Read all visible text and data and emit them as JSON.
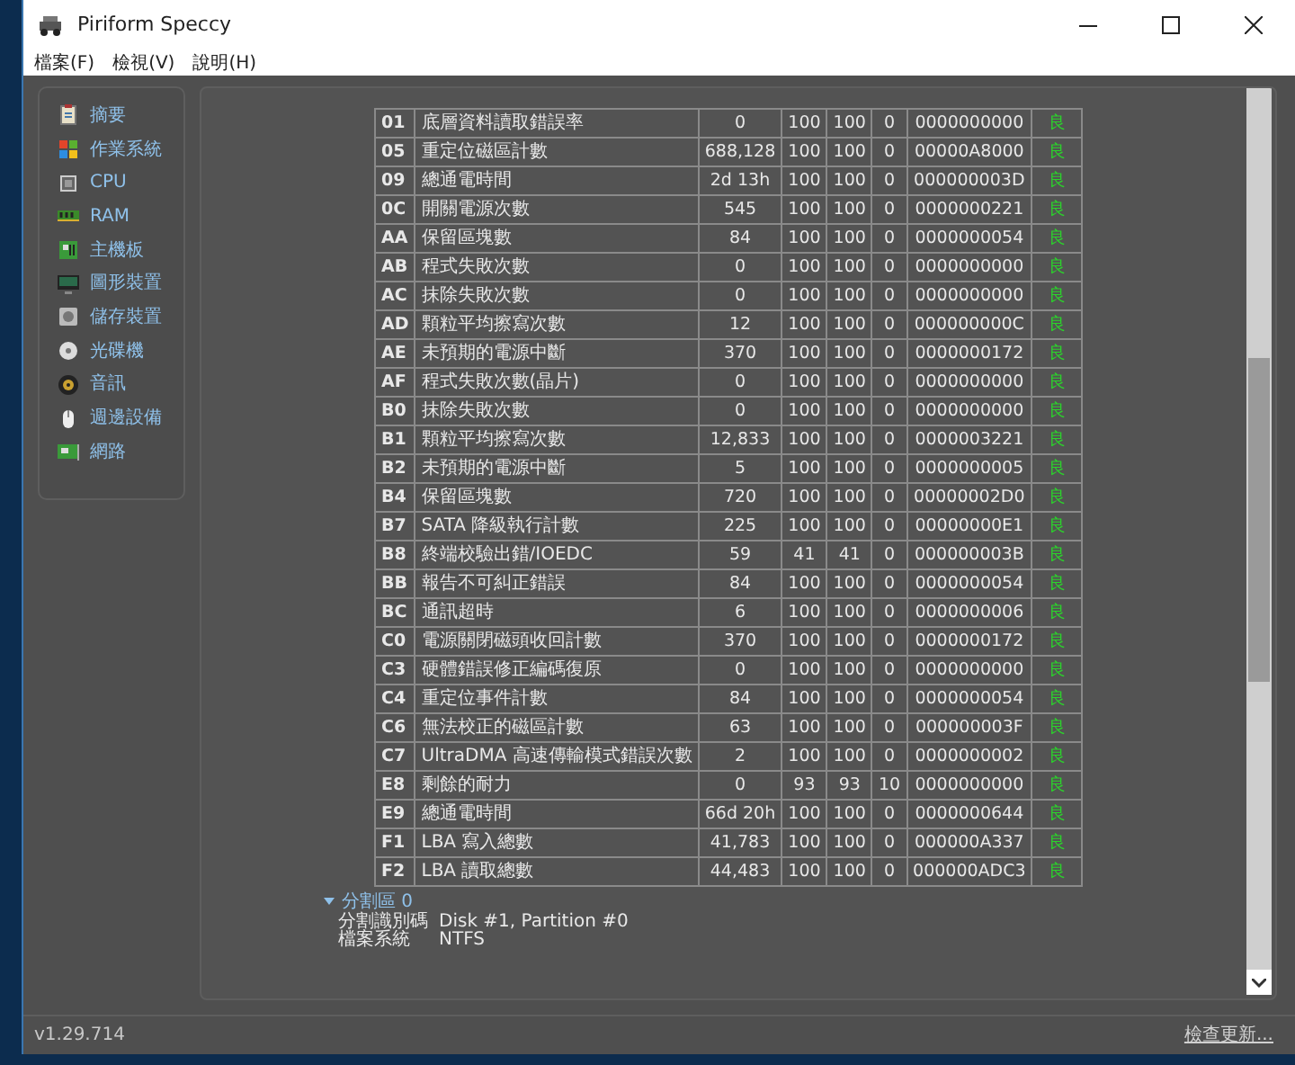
{
  "window": {
    "title": "Piriform Speccy"
  },
  "menu": [
    "檔案(F)",
    "檢視(V)",
    "說明(H)"
  ],
  "sidebar": {
    "items": [
      {
        "label": "摘要",
        "kind": "summary",
        "selected": false
      },
      {
        "label": "作業系統",
        "kind": "os",
        "selected": false
      },
      {
        "label": "CPU",
        "kind": "cpu",
        "selected": false
      },
      {
        "label": "RAM",
        "kind": "ram",
        "selected": false
      },
      {
        "label": "主機板",
        "kind": "board",
        "selected": false
      },
      {
        "label": "圖形裝置",
        "kind": "display",
        "selected": false
      },
      {
        "label": "儲存裝置",
        "kind": "storage",
        "selected": false
      },
      {
        "label": "光碟機",
        "kind": "disc",
        "selected": false
      },
      {
        "label": "音訊",
        "kind": "audio",
        "selected": false
      },
      {
        "label": "週邊設備",
        "kind": "mouse",
        "selected": false
      },
      {
        "label": "網路",
        "kind": "network",
        "selected": false
      }
    ]
  },
  "smart_table": {
    "rows": [
      [
        "01",
        "底層資料讀取錯誤率",
        "0",
        "100",
        "100",
        "0",
        "0000000000",
        "良"
      ],
      [
        "05",
        "重定位磁區計數",
        "688,128",
        "100",
        "100",
        "0",
        "00000A8000",
        "良"
      ],
      [
        "09",
        "總通電時間",
        "2d 13h",
        "100",
        "100",
        "0",
        "000000003D",
        "良"
      ],
      [
        "0C",
        "開關電源次數",
        "545",
        "100",
        "100",
        "0",
        "0000000221",
        "良"
      ],
      [
        "AA",
        "保留區塊數",
        "84",
        "100",
        "100",
        "0",
        "0000000054",
        "良"
      ],
      [
        "AB",
        "程式失敗次數",
        "0",
        "100",
        "100",
        "0",
        "0000000000",
        "良"
      ],
      [
        "AC",
        "抹除失敗次數",
        "0",
        "100",
        "100",
        "0",
        "0000000000",
        "良"
      ],
      [
        "AD",
        "顆粒平均擦寫次數",
        "12",
        "100",
        "100",
        "0",
        "000000000C",
        "良"
      ],
      [
        "AE",
        "未預期的電源中斷",
        "370",
        "100",
        "100",
        "0",
        "0000000172",
        "良"
      ],
      [
        "AF",
        "程式失敗次數(晶片)",
        "0",
        "100",
        "100",
        "0",
        "0000000000",
        "良"
      ],
      [
        "B0",
        "抹除失敗次數",
        "0",
        "100",
        "100",
        "0",
        "0000000000",
        "良"
      ],
      [
        "B1",
        "顆粒平均擦寫次數",
        "12,833",
        "100",
        "100",
        "0",
        "0000003221",
        "良"
      ],
      [
        "B2",
        "未預期的電源中斷",
        "5",
        "100",
        "100",
        "0",
        "0000000005",
        "良"
      ],
      [
        "B4",
        "保留區塊數",
        "720",
        "100",
        "100",
        "0",
        "00000002D0",
        "良"
      ],
      [
        "B7",
        "SATA 降級執行計數",
        "225",
        "100",
        "100",
        "0",
        "00000000E1",
        "良"
      ],
      [
        "B8",
        "終端校驗出錯/IOEDC",
        "59",
        "41",
        "41",
        "0",
        "000000003B",
        "良"
      ],
      [
        "BB",
        "報告不可糾正錯誤",
        "84",
        "100",
        "100",
        "0",
        "0000000054",
        "良"
      ],
      [
        "BC",
        "通訊超時",
        "6",
        "100",
        "100",
        "0",
        "0000000006",
        "良"
      ],
      [
        "C0",
        "電源關閉磁頭收回計數",
        "370",
        "100",
        "100",
        "0",
        "0000000172",
        "良"
      ],
      [
        "C3",
        "硬體錯誤修正編碼復原",
        "0",
        "100",
        "100",
        "0",
        "0000000000",
        "良"
      ],
      [
        "C4",
        "重定位事件計數",
        "84",
        "100",
        "100",
        "0",
        "0000000054",
        "良"
      ],
      [
        "C6",
        "無法校正的磁區計數",
        "63",
        "100",
        "100",
        "0",
        "000000003F",
        "良"
      ],
      [
        "C7",
        "UltraDMA 高速傳輸模式錯誤次數",
        "2",
        "100",
        "100",
        "0",
        "0000000002",
        "良"
      ],
      [
        "E8",
        "剩餘的耐力",
        "0",
        "93",
        "93",
        "10",
        "0000000000",
        "良"
      ],
      [
        "E9",
        "總通電時間",
        "66d 20h",
        "100",
        "100",
        "0",
        "0000000644",
        "良"
      ],
      [
        "F1",
        "LBA 寫入總數",
        "41,783",
        "100",
        "100",
        "0",
        "000000A337",
        "良"
      ],
      [
        "F2",
        "LBA 讀取總數",
        "44,483",
        "100",
        "100",
        "0",
        "000000ADC3",
        "良"
      ]
    ]
  },
  "partition": {
    "title": "分割區 0",
    "expanded": true,
    "fields": [
      {
        "label": "分割識別碼",
        "value": "Disk #1, Partition #0"
      },
      {
        "label": "檔案系統",
        "value": "NTFS"
      }
    ]
  },
  "status_bar": {
    "version": "v1.29.714",
    "link": "檢查更新..."
  }
}
